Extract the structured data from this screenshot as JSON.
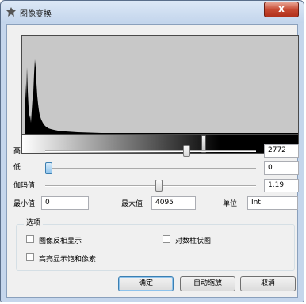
{
  "window": {
    "title": "图像变换",
    "close_label": "x"
  },
  "histogram": {
    "handle_position_fraction": 0.66
  },
  "sliders": [
    {
      "label": "高",
      "value": "2772",
      "thumb_fraction": 0.676
    },
    {
      "label": "低",
      "value": "0",
      "thumb_fraction": 0.0
    },
    {
      "label": "伽玛值",
      "value": "1.19",
      "thumb_fraction": 0.542
    }
  ],
  "range": {
    "min_label": "最小值",
    "min_value": "0",
    "max_label": "最大值",
    "max_value": "4095",
    "unit_label": "单位",
    "unit_value": "Int"
  },
  "options": {
    "title": "选项",
    "invert_label": "图像反相显示",
    "log_bar_label": "对数柱状图",
    "highlight_saturated_label": "高亮显示饱和像素"
  },
  "buttons": {
    "ok": "确定",
    "auto_zoom": "自动缩放",
    "cancel": "取消"
  }
}
